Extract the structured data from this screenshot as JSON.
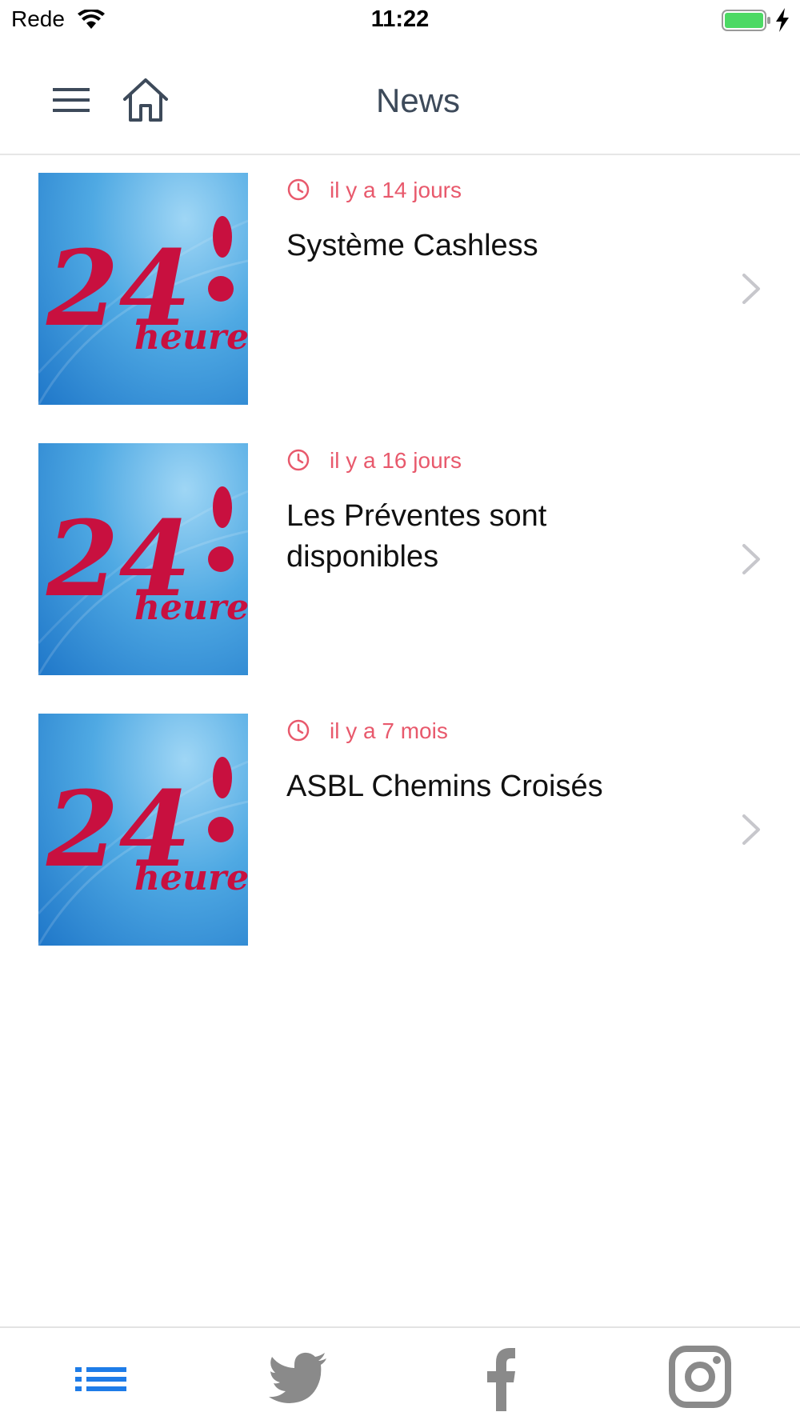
{
  "status_bar": {
    "carrier": "Rede",
    "time": "11:22",
    "battery_color": "#4cd964"
  },
  "header": {
    "title": "News",
    "menu_icon": "hamburger-menu-icon",
    "home_icon": "home-icon"
  },
  "news": {
    "items": [
      {
        "time_ago": "il y a 14 jours",
        "title": "Système Cashless",
        "thumbnail_logo": "24 heures"
      },
      {
        "time_ago": "il y a 16 jours",
        "title": "Les Préventes sont disponibles",
        "thumbnail_logo": "24 heures"
      },
      {
        "time_ago": "il y a 7 mois",
        "title": "ASBL Chemins Croisés",
        "thumbnail_logo": "24 heures"
      }
    ]
  },
  "tab_bar": {
    "tabs": [
      {
        "icon": "list-icon",
        "active": true
      },
      {
        "icon": "twitter-icon",
        "active": false
      },
      {
        "icon": "facebook-icon",
        "active": false
      },
      {
        "icon": "instagram-icon",
        "active": false
      }
    ],
    "active_color": "#1e7ce8",
    "inactive_color": "#8a8a8a"
  },
  "colors": {
    "accent": "#e8596c",
    "title_text": "#3d4a5a",
    "logo_red": "#c8103f",
    "thumbnail_blue": "#3a95dc"
  }
}
